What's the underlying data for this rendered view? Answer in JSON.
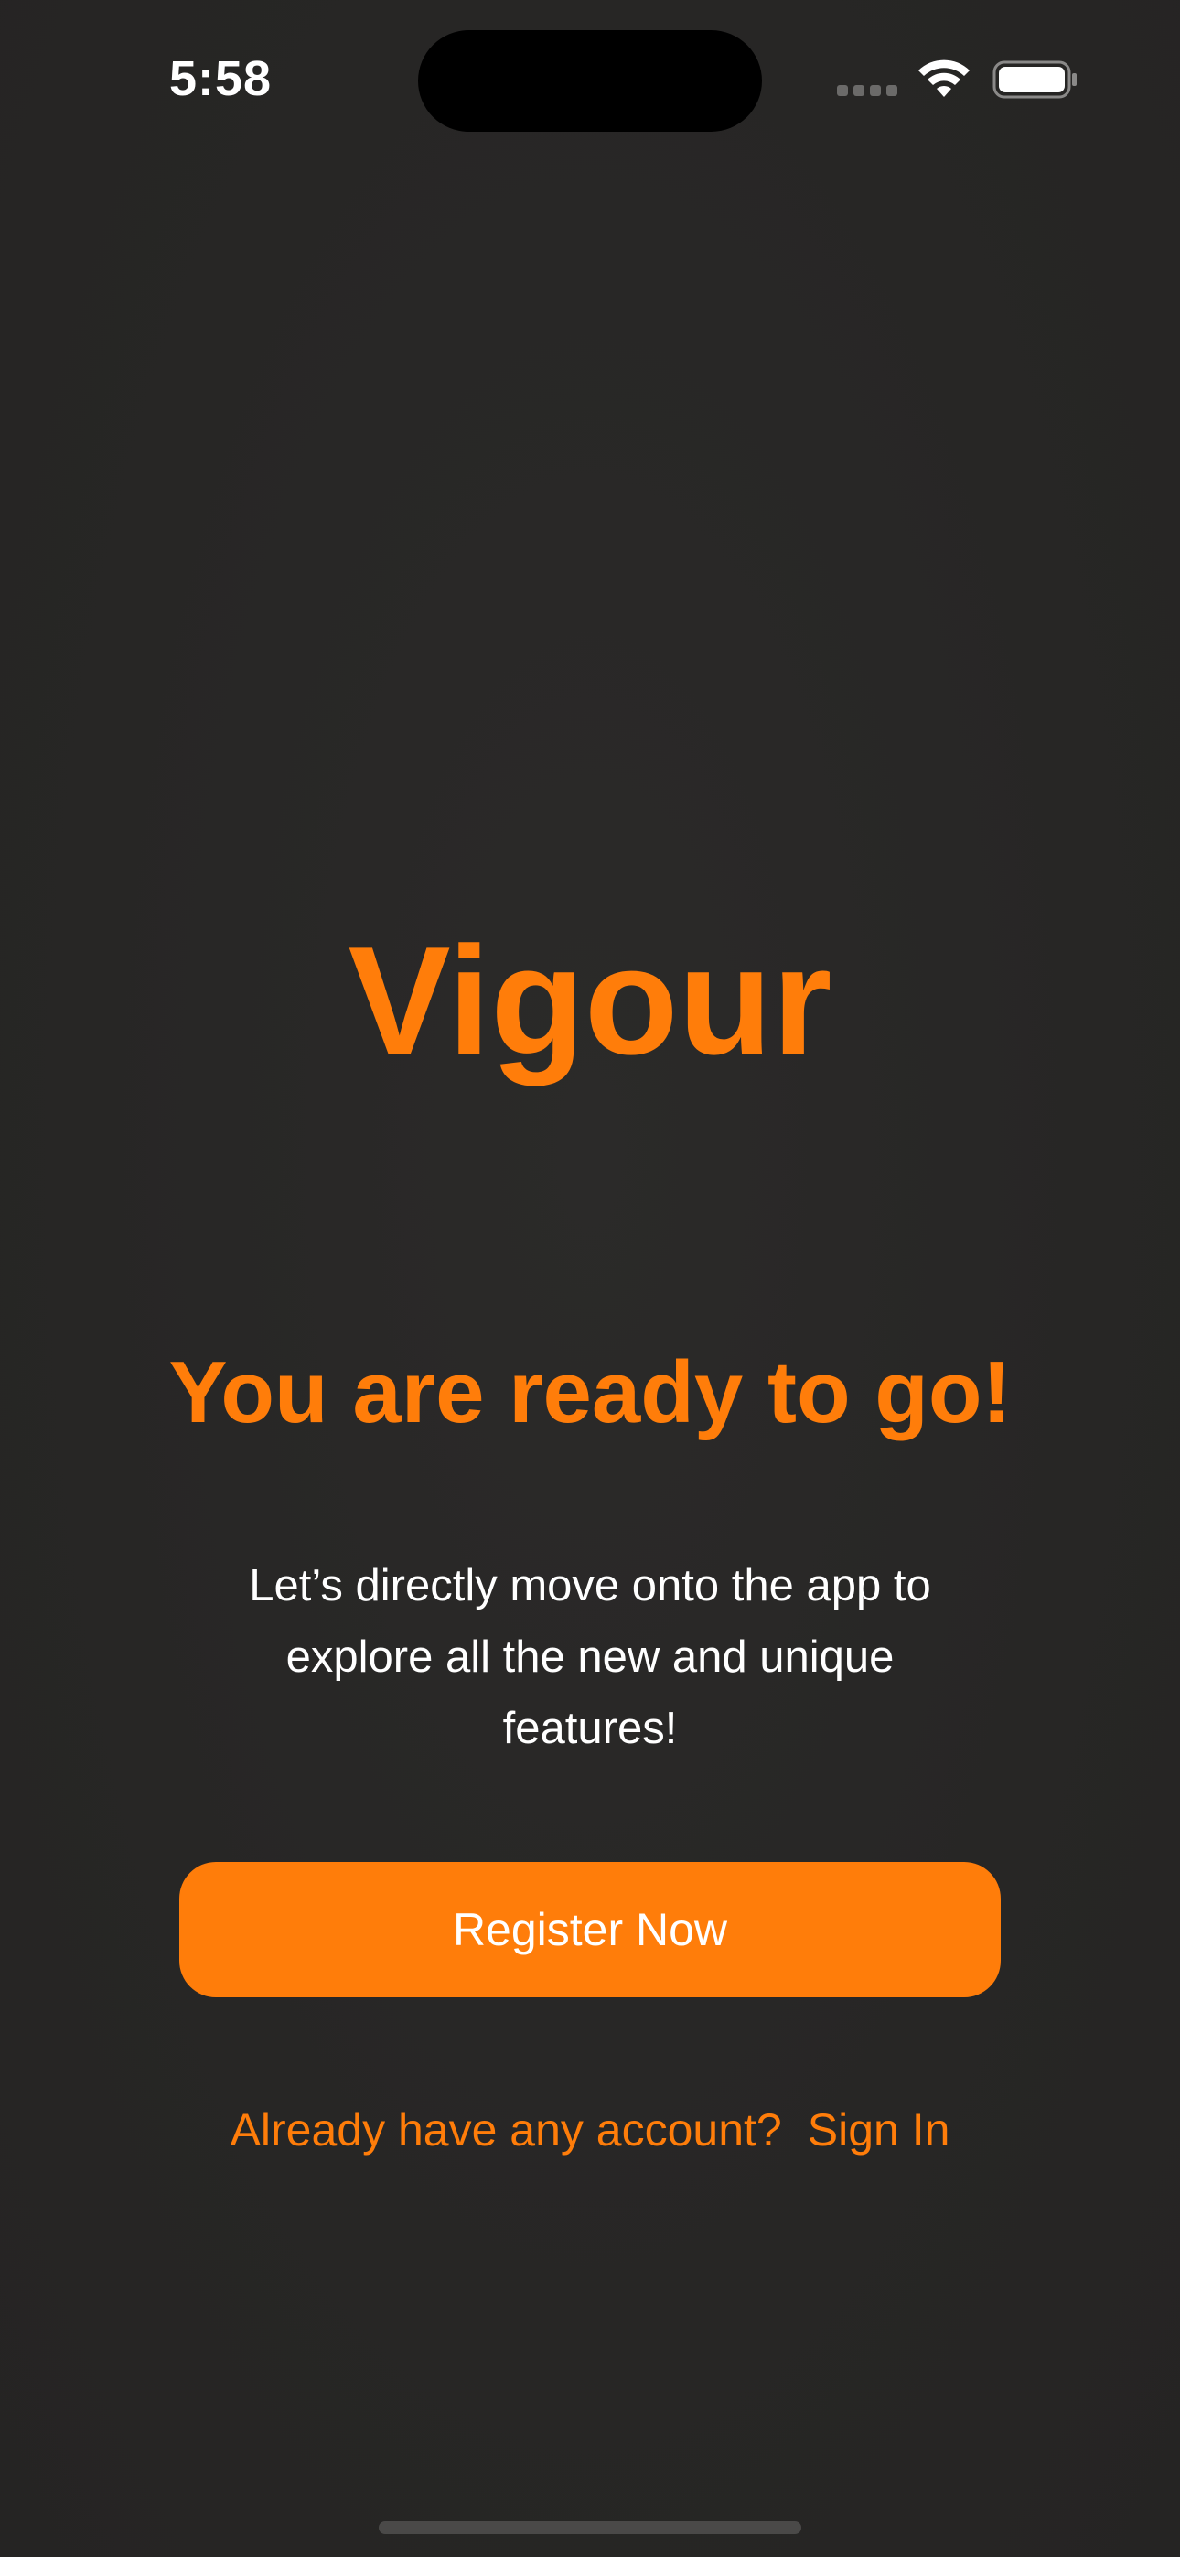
{
  "status_bar": {
    "time": "5:58",
    "icons": [
      "cellular-signal-icon",
      "wifi-icon",
      "battery-icon"
    ]
  },
  "app": {
    "title": "Vigour"
  },
  "main": {
    "headline": "You are ready to go!",
    "description": "Let’s directly move onto the app to explore all the new and unique features!",
    "register_label": "Register Now",
    "signin_prompt": "Already have any account?",
    "signin_label": "Sign In"
  },
  "colors": {
    "accent": "#ff7d0a",
    "background": "#272625",
    "text": "#ffffff"
  }
}
